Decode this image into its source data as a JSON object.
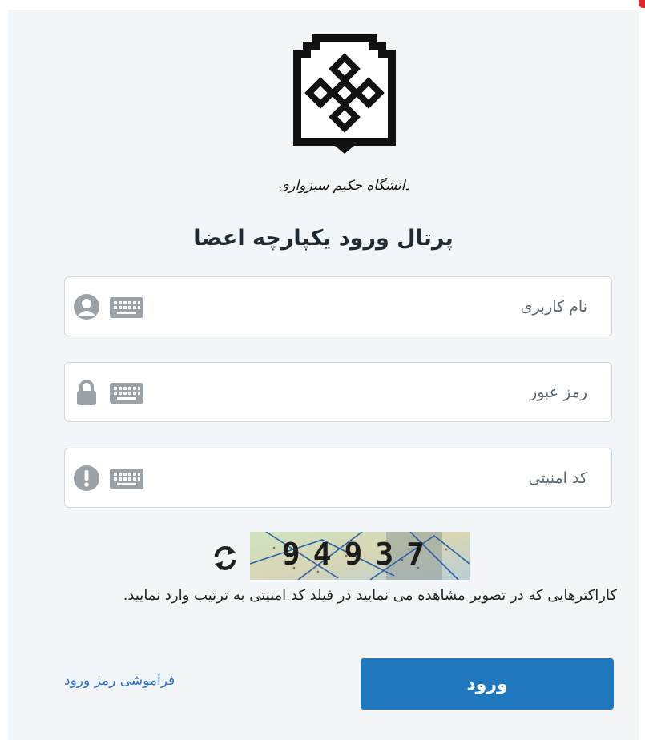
{
  "header": {
    "logo_icon": "university-emblem",
    "university_name": "دانشگاه حکیم سبزواری",
    "portal_title": "پرتال ورود یکپارچه اعضا"
  },
  "form": {
    "username": {
      "placeholder": "نام کاربری",
      "value": "",
      "icon": "user-icon"
    },
    "password": {
      "placeholder": "رمز عبور",
      "value": "",
      "icon": "lock-icon"
    },
    "security_code": {
      "placeholder": "کد امنیتی",
      "value": "",
      "icon": "exclamation-icon"
    },
    "keyboard_icon": "keyboard-icon"
  },
  "captcha": {
    "refresh_icon": "refresh-icon",
    "text": "94937",
    "help_text": "کاراکترهایی که در تصویر مشاهده می نمایید در فیلد کد امنیتی به ترتیب وارد نمایید."
  },
  "actions": {
    "forgot_password": "فراموشی رمز ورود",
    "login": "ورود"
  },
  "colors": {
    "primary": "#1f77bd",
    "link": "#2a6fd0",
    "panel_bg": "#f3f6f9",
    "icon_gray": "#9aa2a8"
  }
}
